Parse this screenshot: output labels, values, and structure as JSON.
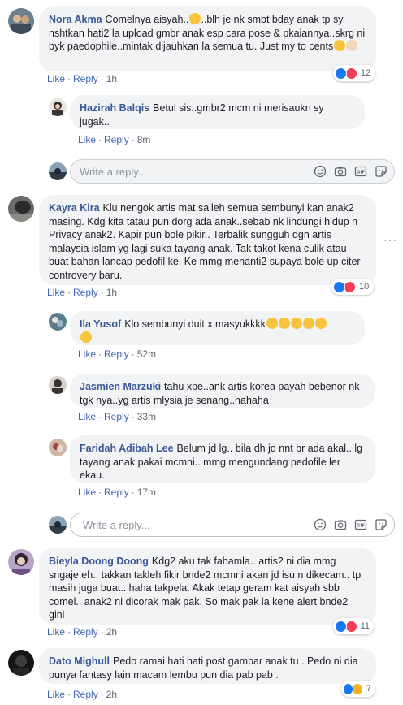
{
  "comments": [
    {
      "author": "Nora Akma",
      "text": "Comelnya aisyah..",
      "text2": "..blh je nk smbt bday anak tp sy nshtkan hati2 la upload gmbr anak esp cara pose & pkaiannya..skrg ni byk paedophile..mintak dijauhkan la semua tu. Just my to cents",
      "like_label": "Like",
      "reply_label": "Reply",
      "time": "1h",
      "reaction_count": "12",
      "reactions": [
        "like",
        "love"
      ]
    },
    {
      "author": "Hazirah Balqis",
      "text": "Betul sis..gmbr2 mcm ni merisaukn sy jugak..",
      "like_label": "Like",
      "reply_label": "Reply",
      "time": "8m"
    },
    {
      "author": "Kayra Kira",
      "text": "Klu nengok artis mat salleh semua sembunyi kan anak2 masing. Kdg kita tatau pun dorg ada anak..sebab nk lindungi hidup n Privacy anak2. Kapir pun bole pikir.. Terbalik sungguh dgn artis malaysia islam yg lagi suka tayang anak. Tak takot kena culik atau buat bahan lancap pedofil ke. Ke mmg menanti2 supaya bole up citer controvery baru.",
      "like_label": "Like",
      "reply_label": "Reply",
      "time": "1h",
      "reaction_count": "10",
      "reactions": [
        "like",
        "love"
      ]
    },
    {
      "author": "Ila Yusof",
      "text": "Klo sembunyi duit x masyukkkk",
      "like_label": "Like",
      "reply_label": "Reply",
      "time": "52m"
    },
    {
      "author": "Jasmien Marzuki",
      "text": "tahu xpe..ank artis korea payah bebenor nk tgk nya..yg artis mlysia je senang..hahaha",
      "like_label": "Like",
      "reply_label": "Reply",
      "time": "33m"
    },
    {
      "author": "Faridah Adibah Lee",
      "text": "Belum jd lg.. bila dh jd nnt br ada akal.. lg tayang anak pakai mcmni.. mmg mengundang pedofile ler ekau..",
      "like_label": "Like",
      "reply_label": "Reply",
      "time": "17m"
    },
    {
      "author": "Bieyla Doong Doong",
      "text": "Kdg2 aku tak fahamla.. artis2 ni dia mmg sngaje eh.. takkan takleh fikir bnde2 mcmni akan jd isu n dikecam.. tp masih juga buat.. haha takpela. Akak tetap geram kat aisyah sbb comel.. anak2 ni dicorak mak pak. So mak pak la kene alert bnde2 gini",
      "like_label": "Like",
      "reply_label": "Reply",
      "time": "2h",
      "reaction_count": "11",
      "reactions": [
        "like",
        "love"
      ]
    },
    {
      "author": "Dato Mighull",
      "text": "Pedo ramai hati hati post gambar anak tu . Pedo ni dia punya fantasy lain macam lembu pun dia pab pab .",
      "like_label": "Like",
      "reply_label": "Reply",
      "time": "2h",
      "reaction_count": "7",
      "reactions": [
        "like",
        "haha"
      ]
    }
  ],
  "reply_boxes": [
    {
      "placeholder": "Write a reply..."
    },
    {
      "placeholder": "Write a reply..."
    }
  ],
  "icons": [
    "emoji-icon",
    "camera-icon",
    "gif-icon",
    "sticker-icon",
    "more-options-icon"
  ],
  "colors": {
    "author": "#385898",
    "link": "#4267b2",
    "bubble": "#f2f3f5",
    "like": "#1877f2",
    "love": "#f33e58"
  }
}
